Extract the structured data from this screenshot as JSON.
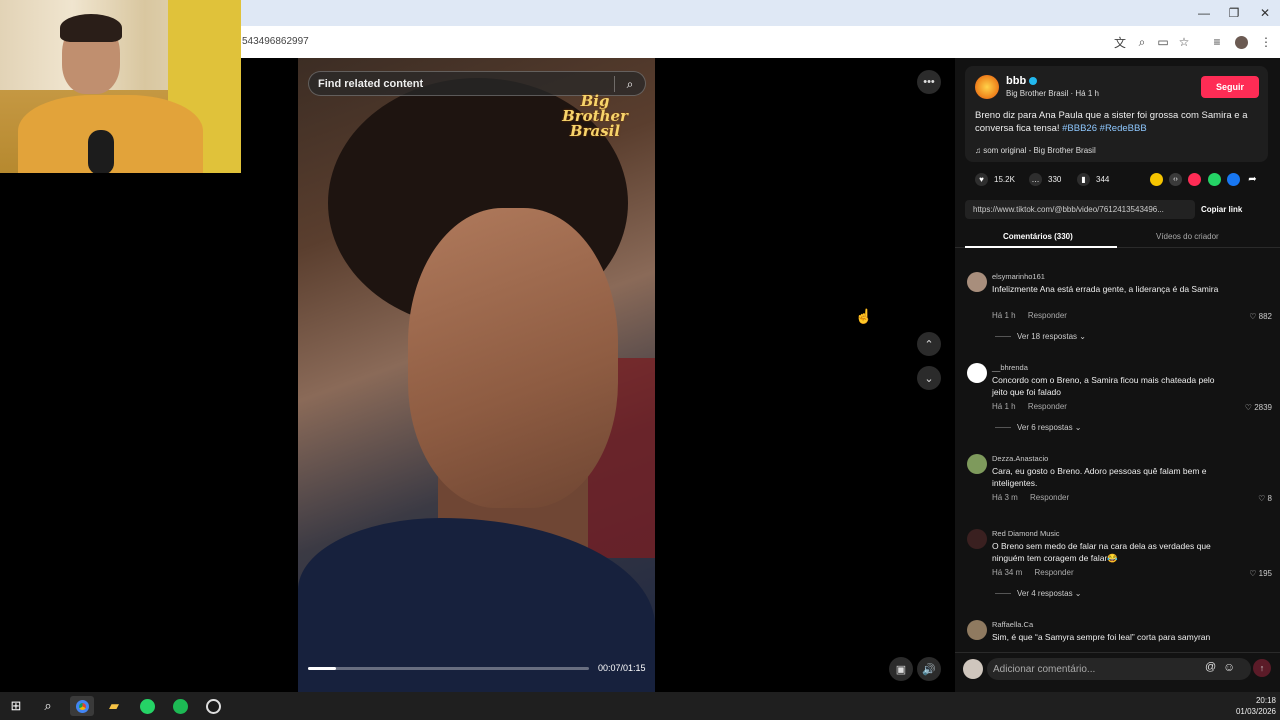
{
  "browser": {
    "url_tail": "543496862997",
    "window_controls": [
      "minimize-icon",
      "restore-icon",
      "close-icon"
    ],
    "toolbar_icons": [
      "translate-icon",
      "zoom-icon",
      "cast-icon",
      "star-icon",
      "reading-list-icon",
      "profile-icon",
      "menu-icon"
    ]
  },
  "video": {
    "search_placeholder": "Find related content",
    "watermark_line1": "Big Brother",
    "watermark_line2": "Brasil",
    "time": "00:07/01:15",
    "progress": 0.1,
    "more_label": "•••"
  },
  "post": {
    "username": "bbb",
    "account_name": "Big Brother Brasil",
    "posted": "Há 1 h",
    "follow_label": "Seguir",
    "caption_text": "Breno diz para Ana Paula que a sister foi grossa com Samira e a conversa fica tensa!",
    "hashtags": [
      "#BBB26",
      "#RedeBBB"
    ],
    "sound": "som original - Big Brother Brasil",
    "likes": "15.2K",
    "comments_count": "330",
    "saves": "344",
    "link": "https://www.tiktok.com/@bbb/video/7612413543496...",
    "copy_link_label": "Copiar link",
    "tab_comments": "Comentários (330)",
    "tab_videos": "Vídeos do criador",
    "share_colors": [
      "#f5c400",
      "#3a3a3a",
      "#fe2c55",
      "#25d366",
      "#1877f2"
    ]
  },
  "comments": [
    {
      "user": "elsymarinho161",
      "text": "Infelizmente Ana está errada gente, a liderança é da Samira",
      "time": "Há 1 h",
      "reply": "Responder",
      "likes": "882",
      "more": "Ver 18 respostas ⌄",
      "avatar_color": "#a88e7c"
    },
    {
      "user": "__bhrenda",
      "text": "Concordo com o Breno, a Samira ficou mais chateada pelo jeito que foi falado",
      "time": "Há 1 h",
      "reply": "Responder",
      "likes": "2839",
      "more": "Ver 6 respostas ⌄",
      "avatar_color": "#ffffff"
    },
    {
      "user": "Dezza.Anastacio",
      "text": "Cara, eu gosto o Breno. Adoro pessoas quê falam bem e inteligentes.",
      "time": "Há 3 m",
      "reply": "Responder",
      "likes": "8",
      "more": "",
      "avatar_color": "#7e9a5c"
    },
    {
      "user": "Red Diamond Music",
      "text": "O Breno sem medo de falar na cara dela as verdades que ninguém tem coragem de falar😂",
      "time": "Há 34 m",
      "reply": "Responder",
      "likes": "195",
      "more": "Ver 4 respostas ⌄",
      "avatar_color": "#3a2020"
    },
    {
      "user": "Raffaella.Ca",
      "text": "Sim, é que “a Samyra sempre foi leal” corta para samyran",
      "time": "",
      "reply": "",
      "likes": "",
      "more": "",
      "avatar_color": "#8f7a60"
    }
  ],
  "composer": {
    "placeholder": "Adicionar comentário...",
    "at": "@",
    "emoji": "☺",
    "send": "↑"
  },
  "taskbar": {
    "icons": [
      "windows-start-icon",
      "search-icon",
      "chrome-icon",
      "file-explorer-icon",
      "whatsapp-icon",
      "spotify-icon",
      "obs-icon"
    ],
    "time": "20:18",
    "date": "01/03/2026"
  }
}
